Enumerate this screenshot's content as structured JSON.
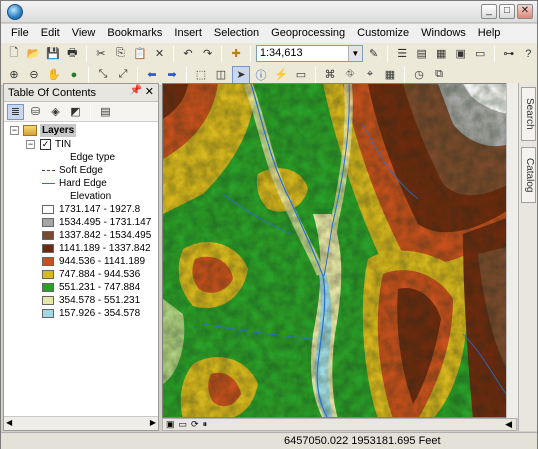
{
  "window": {
    "title": "",
    "controls": [
      "_",
      "□",
      "✕"
    ]
  },
  "menu": [
    "File",
    "Edit",
    "View",
    "Bookmarks",
    "Insert",
    "Selection",
    "Geoprocessing",
    "Customize",
    "Windows",
    "Help"
  ],
  "toolbar": {
    "scale_value": "1:34,613"
  },
  "toc": {
    "title": "Table Of Contents",
    "root_label": "Layers",
    "layer_name": "TIN",
    "edge_heading": "Edge type",
    "edges": [
      {
        "label": "Soft Edge",
        "color": "#7a3a2a",
        "style": "dashed"
      },
      {
        "label": "Hard Edge",
        "color": "#2a6fd0",
        "style": "solid"
      }
    ],
    "elevation_heading": "Elevation",
    "classes": [
      {
        "label": "1731.147 - 1927.8",
        "color": "#ffffff"
      },
      {
        "label": "1534.495 - 1731.147",
        "color": "#a6a6a6"
      },
      {
        "label": "1337.842 - 1534.495",
        "color": "#7b4a2e"
      },
      {
        "label": "1141.189 - 1337.842",
        "color": "#6e2a10"
      },
      {
        "label": "944.536 - 1141.189",
        "color": "#c8501e"
      },
      {
        "label": "747.884 - 944.536",
        "color": "#d9b81f"
      },
      {
        "label": "551.231 - 747.884",
        "color": "#2aa02a"
      },
      {
        "label": "354.578 - 551.231",
        "color": "#e8e6a8"
      },
      {
        "label": "157.926 - 354.578",
        "color": "#9ed8e0"
      }
    ]
  },
  "dock": {
    "search_label": "Search",
    "catalog_label": "Catalog"
  },
  "status": {
    "coordinates": "6457050.022  1953181.695 Feet"
  }
}
